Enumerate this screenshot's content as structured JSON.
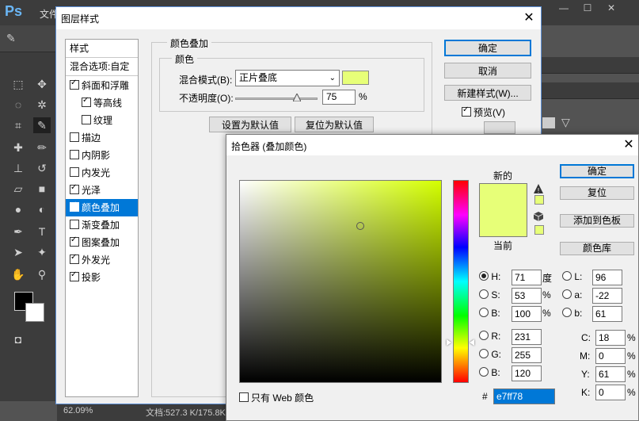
{
  "app": {
    "logo": "Ps",
    "menu_first": "文件",
    "status_zoom": "62.09%",
    "status_doc": "文档:527.3 K/175.8K",
    "win_buttons": [
      "—",
      "☐",
      "✕"
    ]
  },
  "layer_style": {
    "title": "图层样式",
    "list_header": "样式",
    "blend_options": "混合选项:自定",
    "items": [
      {
        "label": "斜面和浮雕",
        "checked": true,
        "indent": false
      },
      {
        "label": "等高线",
        "checked": true,
        "indent": true
      },
      {
        "label": "纹理",
        "checked": false,
        "indent": true
      },
      {
        "label": "描边",
        "checked": false,
        "indent": false
      },
      {
        "label": "内阴影",
        "checked": false,
        "indent": false
      },
      {
        "label": "内发光",
        "checked": false,
        "indent": false
      },
      {
        "label": "光泽",
        "checked": true,
        "indent": false
      },
      {
        "label": "颜色叠加",
        "checked": true,
        "indent": false,
        "selected": true
      },
      {
        "label": "渐变叠加",
        "checked": false,
        "indent": false
      },
      {
        "label": "图案叠加",
        "checked": true,
        "indent": false
      },
      {
        "label": "外发光",
        "checked": true,
        "indent": false
      },
      {
        "label": "投影",
        "checked": true,
        "indent": false
      }
    ],
    "group_title": "颜色叠加",
    "sub_title": "颜色",
    "blend_mode_label": "混合模式(B):",
    "blend_mode_value": "正片叠底",
    "opacity_label": "不透明度(O):",
    "opacity_value": "75",
    "opacity_unit": "%",
    "opacity_fraction": 0.75,
    "overlay_color": "#e7ff78",
    "set_default": "设置为默认值",
    "reset_default": "复位为默认值",
    "ok": "确定",
    "cancel": "取消",
    "new_style": "新建样式(W)...",
    "preview_label": "预览(V)",
    "preview_checked": true
  },
  "color_picker": {
    "title": "拾色器 (叠加颜色)",
    "new_label": "新的",
    "current_label": "当前",
    "new_color": "#e7ff78",
    "current_color": "#e7ff78",
    "ok": "确定",
    "reset": "复位",
    "add_swatch": "添加到色板",
    "color_libraries": "颜色库",
    "web_only_label": "只有 Web 颜色",
    "hsb": [
      {
        "key": "H:",
        "value": "71",
        "unit": "度",
        "selected": true
      },
      {
        "key": "S:",
        "value": "53",
        "unit": "%",
        "selected": false
      },
      {
        "key": "B:",
        "value": "100",
        "unit": "%",
        "selected": false
      }
    ],
    "rgb": [
      {
        "key": "R:",
        "value": "231"
      },
      {
        "key": "G:",
        "value": "255"
      },
      {
        "key": "B:",
        "value": "120"
      }
    ],
    "lab": [
      {
        "key": "L:",
        "value": "96"
      },
      {
        "key": "a:",
        "value": "-22"
      },
      {
        "key": "b:",
        "value": "61"
      }
    ],
    "cmyk": [
      {
        "key": "C:",
        "value": "18",
        "unit": "%"
      },
      {
        "key": "M:",
        "value": "0",
        "unit": "%"
      },
      {
        "key": "Y:",
        "value": "61",
        "unit": "%"
      },
      {
        "key": "K:",
        "value": "0",
        "unit": "%"
      }
    ],
    "hex_label": "#",
    "hex_value": "e7ff78",
    "warn_icon": "gamut-warning-icon",
    "web_icon": "web-safe-cube-icon"
  }
}
